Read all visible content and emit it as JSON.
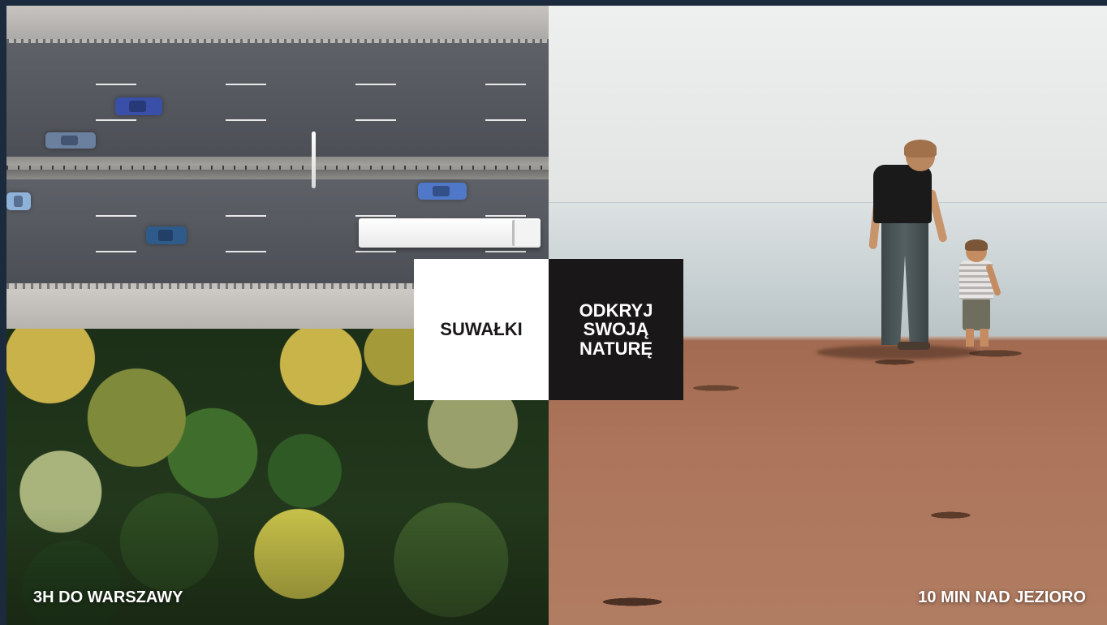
{
  "center": {
    "city": "SUWAŁKI",
    "tagline_lines": [
      "ODKRYJ",
      "SWOJĄ",
      "NATURĘ"
    ]
  },
  "captions": {
    "left": "3H DO WARSZAWY",
    "right": "10 MIN NAD JEZIORO"
  },
  "colors": {
    "frame": "#1b2a3c",
    "block_light": "#ffffff",
    "block_dark": "#1a1718",
    "text_light": "#ffffff",
    "text_dark": "#1a1718"
  }
}
